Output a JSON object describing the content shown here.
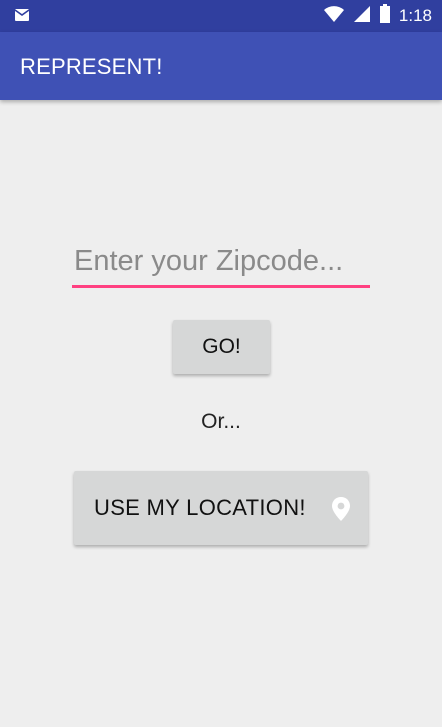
{
  "status_bar": {
    "time": "1:18",
    "icons": [
      "notification-mail-icon",
      "wifi-icon",
      "signal-icon",
      "battery-icon"
    ]
  },
  "app_bar": {
    "title": "REPRESENT!"
  },
  "main": {
    "zipcode": {
      "placeholder": "Enter your Zipcode...",
      "value": ""
    },
    "go_label": "GO!",
    "or_text": "Or...",
    "location_label": "USE MY LOCATION!",
    "location_icon": "location-pin-icon"
  },
  "colors": {
    "status_bar": "#303f9f",
    "app_bar": "#3f51b5",
    "accent": "#ff4081",
    "background": "#eeeeee",
    "button": "#d6d7d7"
  }
}
